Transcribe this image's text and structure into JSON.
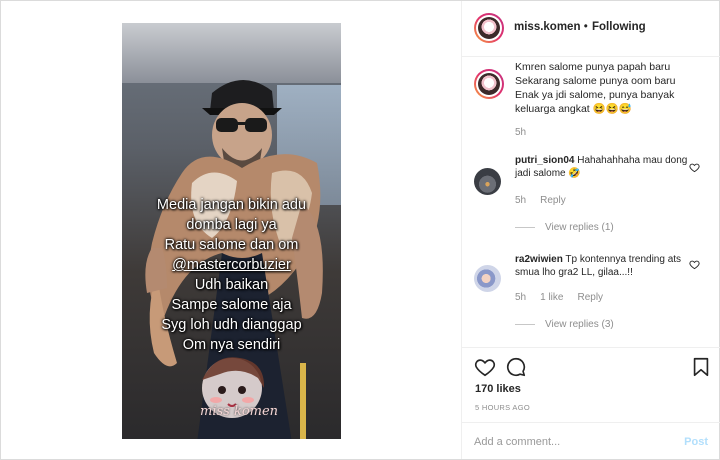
{
  "post": {
    "username": "miss.komen",
    "separator": "•",
    "following_label": "Following"
  },
  "story": {
    "caption_lines": [
      "Media jangan bikin adu",
      "domba lagi ya",
      "Ratu salome dan om",
      "@mastercorbuzier",
      "Udh baikan",
      "Sampe salome aja",
      "Syg loh udh dianggap",
      "Om nya sendiri"
    ],
    "sticker_label": "miss komen"
  },
  "caption": {
    "lines": [
      "Kmren salome punya papah baru",
      "Sekarang salome punya oom baru",
      "Enak ya jdi salome, punya banyak",
      "keluarga angkat 😆😆😅"
    ],
    "time": "5h"
  },
  "comments": [
    {
      "user": "putri_sion04",
      "text": "Hahahahhaha mau dong jadi salome 🤣",
      "time": "5h",
      "likes": "",
      "reply_label": "Reply",
      "view_replies": "View replies (1)"
    },
    {
      "user": "ra2wiwien",
      "text": "Tp kontennya trending ats smua lho gra2 LL, gilaa...!!",
      "time": "5h",
      "likes": "1 like",
      "reply_label": "Reply",
      "view_replies": "View replies (3)"
    }
  ],
  "stats": {
    "likes": "170 likes",
    "posted": "5 HOURS AGO"
  },
  "add_comment": {
    "placeholder": "Add a comment...",
    "post_label": "Post"
  },
  "icons": {
    "like": "heart-icon",
    "comment": "speech-bubble-icon",
    "save": "bookmark-icon",
    "comment_like": "small-heart-icon"
  },
  "colors": {
    "text": "#262626",
    "muted": "#8e8e8e",
    "post_button_disabled": "#b2dffc",
    "border": "#efefef"
  }
}
